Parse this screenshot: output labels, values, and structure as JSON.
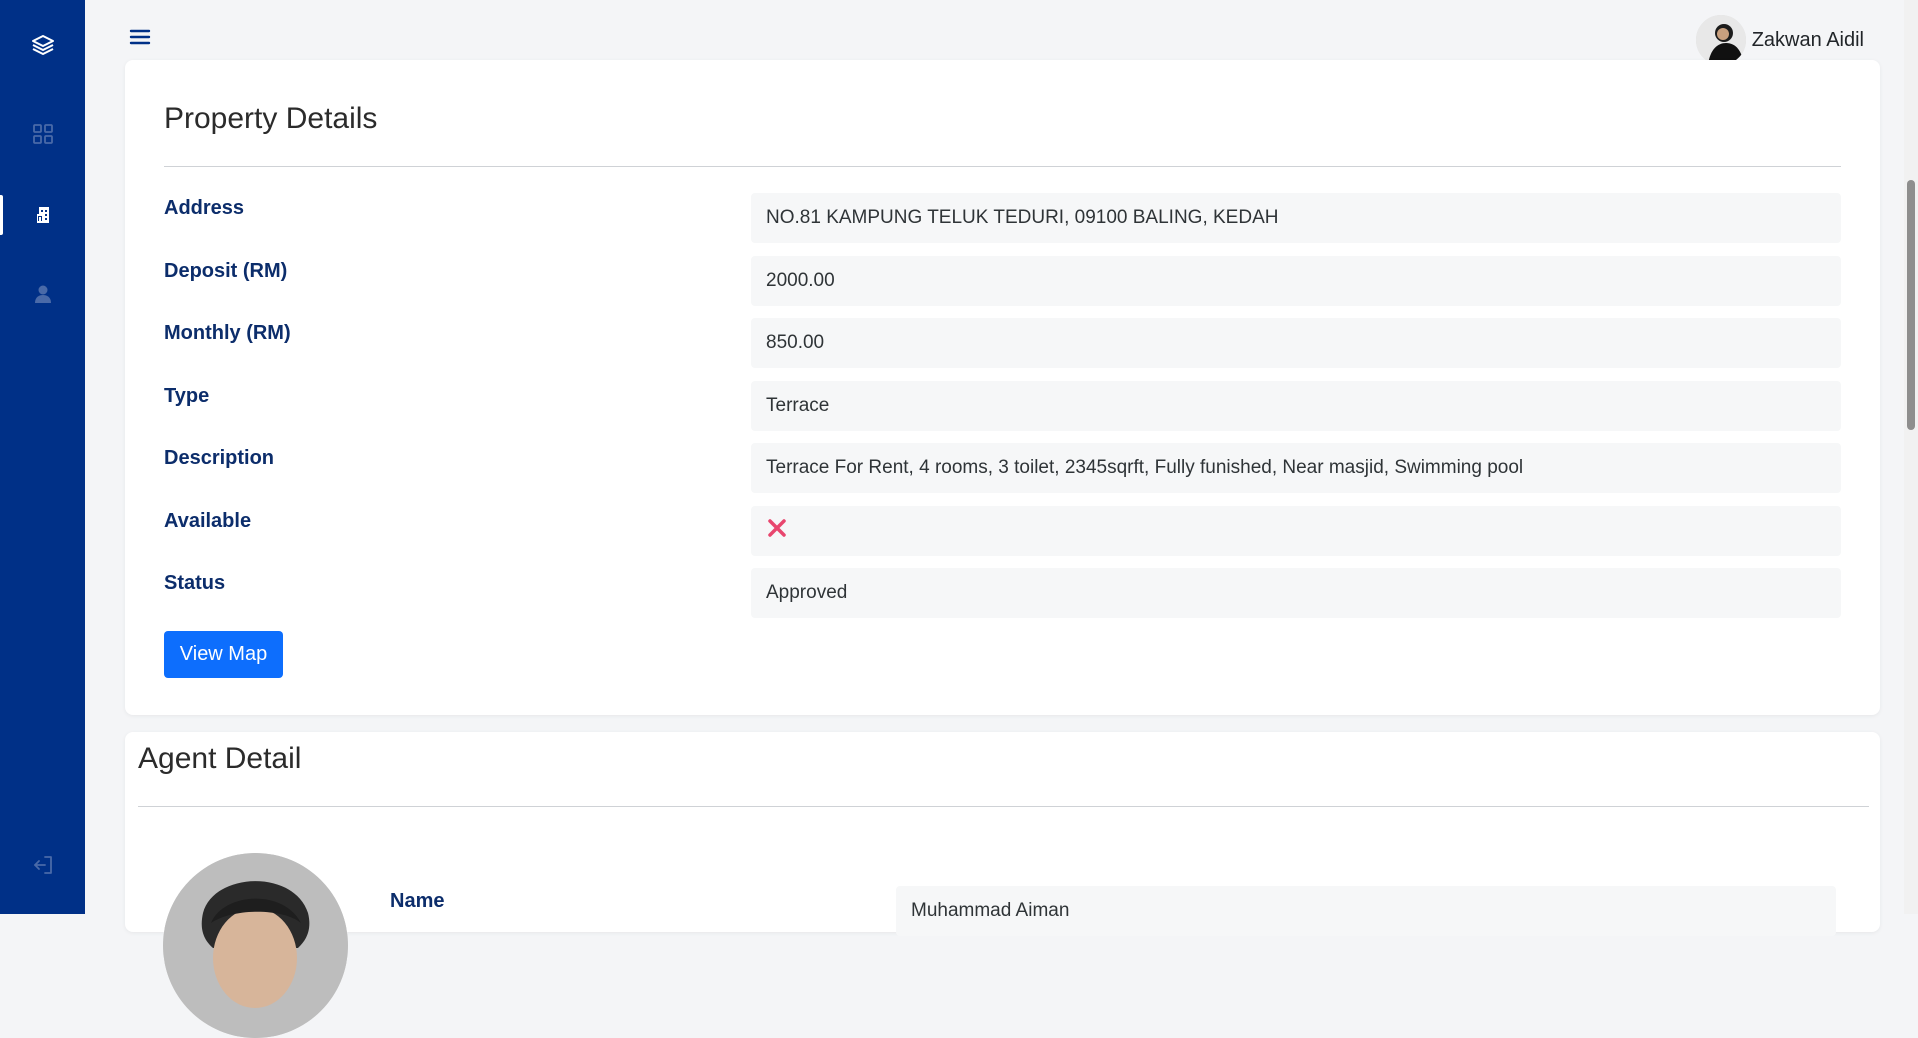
{
  "sidebar": {
    "items": [
      {
        "icon": "layers-icon"
      },
      {
        "icon": "grid-icon"
      },
      {
        "icon": "building-icon"
      },
      {
        "icon": "user-icon"
      },
      {
        "icon": "logout-icon"
      }
    ]
  },
  "topbar": {
    "user_name": "Zakwan Aidil"
  },
  "property": {
    "title": "Property Details",
    "fields": [
      {
        "label": "Address",
        "value": "NO.81 KAMPUNG TELUK TEDURI, 09100 BALING, KEDAH"
      },
      {
        "label": "Deposit (RM)",
        "value": "2000.00"
      },
      {
        "label": "Monthly (RM)",
        "value": "850.00"
      },
      {
        "label": "Type",
        "value": "Terrace"
      },
      {
        "label": "Description",
        "value": "Terrace For Rent, 4 rooms, 3 toilet, 2345sqrft, Fully funished, Near masjid, Swimming pool"
      },
      {
        "label": "Available",
        "value": ""
      },
      {
        "label": "Status",
        "value": "Approved"
      }
    ],
    "view_map_label": "View Map"
  },
  "agent": {
    "title": "Agent Detail",
    "name_label": "Name",
    "name_value": "Muhammad Aiman"
  },
  "colors": {
    "sidebar_bg": "#003087",
    "primary": "#0d6efd",
    "cross": "#e8466e"
  }
}
